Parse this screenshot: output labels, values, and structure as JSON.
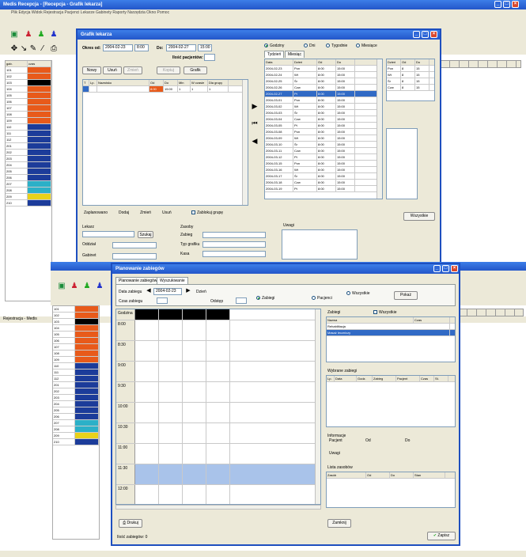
{
  "top_app": {
    "title": "Medis Recepcja - [Recepcja - Grafik lekarza]",
    "menu": "Plik  Edycja  Widok  Rejestracja  Pacjenci  Lekarze  Gabinety  Raporty  Narzędzia  Okno  Pomoc",
    "col_headers": [
      "gab.",
      "czas"
    ],
    "rows": [
      "101",
      "102",
      "103",
      "104",
      "105",
      "106",
      "107",
      "108",
      "109",
      "110",
      "111",
      "112",
      "201",
      "202",
      "203",
      "204",
      "205",
      "206",
      "207",
      "208",
      "209",
      "210"
    ],
    "status": "Rejestracja - Medis"
  },
  "dialog1": {
    "title": "Grafik lekarza",
    "okres_label": "Okres od:",
    "date_from": "2004-02-23",
    "time_from": "8:00",
    "do_label": "Do:",
    "date_to": "2004-02-27",
    "time_to": "15:00",
    "ilosc_label": "Ilość pacjentów:",
    "btns": [
      "Nowy",
      "Usuń",
      "Zmień",
      "Kopiuj",
      "Grafik"
    ],
    "cols": [
      "T",
      "Lp.",
      "Nazwisko",
      "Od",
      "Do",
      "Min",
      "W czasie",
      "Dla grupy"
    ],
    "row": {
      "od": "8:00",
      "do": "15:00",
      "min": "1",
      "wc": "1",
      "g": "1"
    },
    "summary": [
      "Zaplanowano",
      "Dodaj",
      "Zmień",
      "Usuń"
    ],
    "checkbox": "Zablokuj grupę",
    "lekarz_label": "Lekarz",
    "szukaj_btn": "Szukaj",
    "oddzial_label": "Oddział",
    "gabinet_label": "Gabinet",
    "zasoby_label": "Zasoby",
    "zabieg_label": "Zabieg",
    "typ_label": "Typ grafiku",
    "kasa_label": "Kasa",
    "uwagi_label": "Uwagi",
    "right": {
      "radio1": "Godziny",
      "radio2": "Dni",
      "radio3": "Tygodnie",
      "radio4": "Miesiące",
      "tabs": [
        "Tydzień",
        "Miesiąc"
      ],
      "cols": [
        "Data",
        "Dzień",
        "Od",
        "Do"
      ],
      "rows": [
        [
          "2004-02-23",
          "Pon",
          "8:00",
          "15:00"
        ],
        [
          "2004-02-24",
          "Wt",
          "8:00",
          "15:00"
        ],
        [
          "2004-02-25",
          "Śr",
          "8:00",
          "15:00"
        ],
        [
          "2004-02-26",
          "Czw",
          "8:00",
          "15:00"
        ],
        [
          "2004-02-27",
          "Pt",
          "8:00",
          "15:00"
        ],
        [
          "2004-03-01",
          "Pon",
          "8:00",
          "15:00"
        ],
        [
          "2004-03-02",
          "Wt",
          "8:00",
          "15:00"
        ],
        [
          "2004-03-03",
          "Śr",
          "8:00",
          "15:00"
        ],
        [
          "2004-03-04",
          "Czw",
          "8:00",
          "15:00"
        ],
        [
          "2004-03-05",
          "Pt",
          "8:00",
          "15:00"
        ],
        [
          "2004-03-08",
          "Pon",
          "8:00",
          "15:00"
        ],
        [
          "2004-03-09",
          "Wt",
          "8:00",
          "15:00"
        ],
        [
          "2004-03-10",
          "Śr",
          "8:00",
          "15:00"
        ],
        [
          "2004-03-11",
          "Czw",
          "8:00",
          "15:00"
        ],
        [
          "2004-03-12",
          "Pt",
          "8:00",
          "15:00"
        ],
        [
          "2004-03-15",
          "Pon",
          "8:00",
          "15:00"
        ],
        [
          "2004-03-16",
          "Wt",
          "8:00",
          "15:00"
        ],
        [
          "2004-03-17",
          "Śr",
          "8:00",
          "15:00"
        ],
        [
          "2004-03-18",
          "Czw",
          "8:00",
          "15:00"
        ],
        [
          "2004-03-19",
          "Pt",
          "8:00",
          "15:00"
        ]
      ],
      "mini_cols": [
        "Dzień",
        "Od",
        "Do"
      ],
      "mini_rows": [
        [
          "Pon",
          "8",
          "15"
        ],
        [
          "Wt",
          "8",
          "15"
        ],
        [
          "Śr",
          "8",
          "15"
        ],
        [
          "Czw",
          "8",
          "15"
        ]
      ],
      "zapisz_btn": "Wszystkie"
    }
  },
  "dialog2": {
    "title": "Planowanie zabiegów",
    "tabs": [
      "Planowanie zabiegów",
      "Wyszukiwanie"
    ],
    "data_label": "Data zabiegu",
    "date": "2004-02-23",
    "dzien_label": "Dzień",
    "czas_label": "Czas zabiegu",
    "odstep_label": "Odstęp",
    "radio_a": "Zabiegi",
    "radio_b": "Pacjenci",
    "radio_c": "Wszystkie",
    "pokaz_btn": "Pokaż",
    "times": [
      "Godzina",
      "8:00",
      "8:30",
      "9:00",
      "9:30",
      "10:00",
      "10:30",
      "11:00",
      "11:30",
      "12:00"
    ],
    "right_top_label": "Zabiegi",
    "right_chk": "Wszystkie",
    "right_cols": [
      "Nazwa",
      "Czas"
    ],
    "right_rows": [
      "Rehabilitacja",
      "Masaż leczniczy"
    ],
    "wybrane_label": "Wybrane zabiegi",
    "wybrane_cols": [
      "Lp.",
      "Data",
      "Godz.",
      "Zabieg",
      "Pacjent",
      "Czas",
      "St."
    ],
    "info_label": "Informacje",
    "pacjent_label": "Pacjent",
    "od_label": "Od",
    "do_label": "Do",
    "uwagi_label": "Uwagi",
    "lista_label": "Lista zasobów",
    "lista_cols": [
      "Zasób",
      "Od",
      "Do",
      "Stan"
    ],
    "drukuj_btn": "Drukuj",
    "zamknij_btn": "Zamknij",
    "zapisz_btn": "Zapisz",
    "status": "Ilość zabiegów: 0"
  }
}
